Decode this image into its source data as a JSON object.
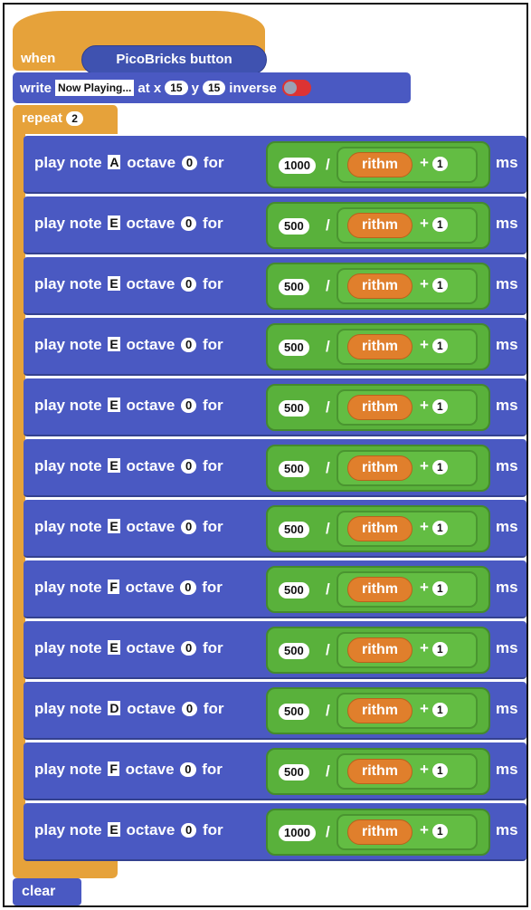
{
  "hat": {
    "when": "when",
    "event": "PicoBricks button"
  },
  "write": {
    "label": "write",
    "text": "Now Playing...",
    "at_x": "at x",
    "x": "15",
    "y_label": "y",
    "y": "15",
    "inverse": "inverse"
  },
  "repeat": {
    "label": "repeat",
    "count": "2"
  },
  "play_note_label": "play note",
  "octave_label": "octave",
  "for_label": "for",
  "slash": "/",
  "plus": "+",
  "ms": "ms",
  "variable": "rithm",
  "addend": "1",
  "notes": [
    {
      "note": "A",
      "octave": "0",
      "duration": "1000"
    },
    {
      "note": "E",
      "octave": "0",
      "duration": "500"
    },
    {
      "note": "E",
      "octave": "0",
      "duration": "500"
    },
    {
      "note": "E",
      "octave": "0",
      "duration": "500"
    },
    {
      "note": "E",
      "octave": "0",
      "duration": "500"
    },
    {
      "note": "E",
      "octave": "0",
      "duration": "500"
    },
    {
      "note": "E",
      "octave": "0",
      "duration": "500"
    },
    {
      "note": "F",
      "octave": "0",
      "duration": "500"
    },
    {
      "note": "E",
      "octave": "0",
      "duration": "500"
    },
    {
      "note": "D",
      "octave": "0",
      "duration": "500"
    },
    {
      "note": "F",
      "octave": "0",
      "duration": "500"
    },
    {
      "note": "E",
      "octave": "0",
      "duration": "1000"
    }
  ],
  "clear": "clear",
  "colors": {
    "event_orange": "#e6a23a",
    "block_blue": "#4a59c2",
    "math_green": "#59b13b",
    "variable_orange": "#e07f2c"
  }
}
